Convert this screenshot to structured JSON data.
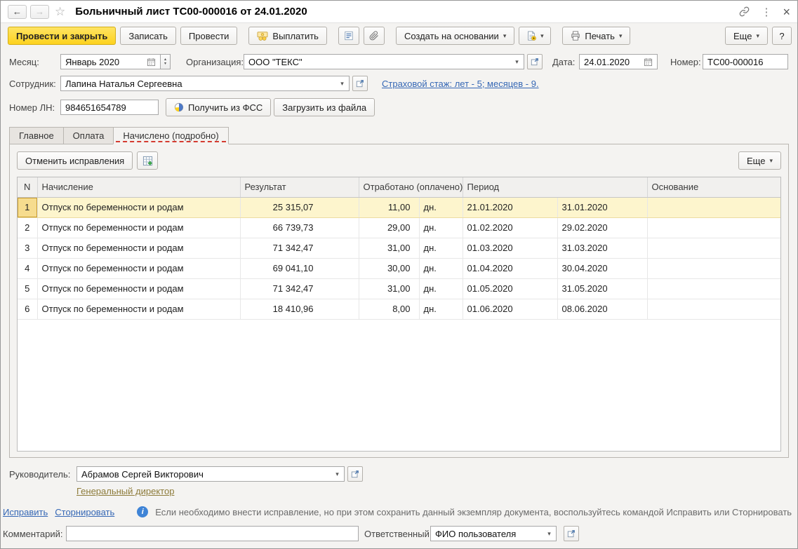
{
  "window": {
    "title": "Больничный лист ТС00-000016 от 24.01.2020"
  },
  "toolbar": {
    "post_and_close": "Провести и закрыть",
    "write": "Записать",
    "post": "Провести",
    "pay": "Выплатить",
    "create_based_on": "Создать на основании",
    "print": "Печать",
    "more": "Еще",
    "help": "?"
  },
  "header_fields": {
    "month": {
      "label": "Месяц:",
      "value": "Январь 2020"
    },
    "organization": {
      "label": "Организация:",
      "value": "ООО \"ТЕКС\""
    },
    "date": {
      "label": "Дата:",
      "value": "24.01.2020"
    },
    "number": {
      "label": "Номер:",
      "value": "ТС00-000016"
    },
    "employee": {
      "label": "Сотрудник:",
      "value": "Лапина Наталья Сергеевна"
    },
    "insurance_record_link": "Страховой стаж: лет - 5; месяцев - 9.",
    "sick_leave_number": {
      "label": "Номер ЛН:",
      "value": "984651654789"
    },
    "get_from_fss": "Получить из ФСС",
    "load_from_file": "Загрузить из файла"
  },
  "tabs": [
    {
      "label": "Главное"
    },
    {
      "label": "Оплата"
    },
    {
      "label": "Начислено (подробно)"
    }
  ],
  "panel": {
    "cancel_corrections": "Отменить исправления",
    "more": "Еще"
  },
  "table": {
    "headers": {
      "n": "N",
      "accrual": "Начисление",
      "result": "Результат",
      "worked": "Отработано (оплачено)",
      "period": "Период",
      "basis": "Основание"
    },
    "rows": [
      {
        "n": "1",
        "accrual": "Отпуск по беременности и родам",
        "result": "25 315,07",
        "worked": "11,00",
        "unit": "дн.",
        "period_start": "21.01.2020",
        "period_end": "31.01.2020",
        "basis": "",
        "selected": true
      },
      {
        "n": "2",
        "accrual": "Отпуск по беременности и родам",
        "result": "66 739,73",
        "worked": "29,00",
        "unit": "дн.",
        "period_start": "01.02.2020",
        "period_end": "29.02.2020",
        "basis": "",
        "selected": false
      },
      {
        "n": "3",
        "accrual": "Отпуск по беременности и родам",
        "result": "71 342,47",
        "worked": "31,00",
        "unit": "дн.",
        "period_start": "01.03.2020",
        "period_end": "31.03.2020",
        "basis": "",
        "selected": false
      },
      {
        "n": "4",
        "accrual": "Отпуск по беременности и родам",
        "result": "69 041,10",
        "worked": "30,00",
        "unit": "дн.",
        "period_start": "01.04.2020",
        "period_end": "30.04.2020",
        "basis": "",
        "selected": false
      },
      {
        "n": "5",
        "accrual": "Отпуск по беременности и родам",
        "result": "71 342,47",
        "worked": "31,00",
        "unit": "дн.",
        "period_start": "01.05.2020",
        "period_end": "31.05.2020",
        "basis": "",
        "selected": false
      },
      {
        "n": "6",
        "accrual": "Отпуск по беременности и родам",
        "result": "18 410,96",
        "worked": "8,00",
        "unit": "дн.",
        "period_start": "01.06.2020",
        "period_end": "08.06.2020",
        "basis": "",
        "selected": false
      }
    ]
  },
  "footer": {
    "manager": {
      "label": "Руководитель:",
      "value": "Абрамов Сергей Викторович"
    },
    "manager_position_link": "Генеральный директор",
    "fix_link": "Исправить",
    "reverse_link": "Сторнировать",
    "hint": "Если необходимо внести исправление, но при этом сохранить данный экземпляр документа, воспользуйтесь командой Исправить или Сторнировать",
    "comment": {
      "label": "Комментарий:",
      "value": ""
    },
    "responsible": {
      "label": "Ответственный:",
      "value": "ФИО пользователя"
    }
  }
}
